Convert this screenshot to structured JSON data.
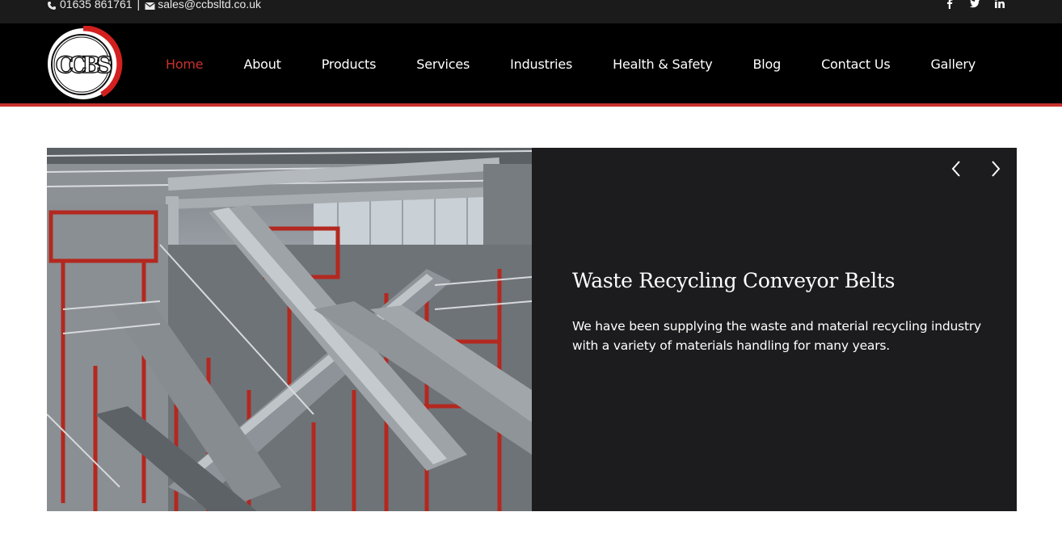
{
  "topbar": {
    "phone": "01635 861761",
    "separator": "|",
    "email": "sales@ccbsltd.co.uk",
    "social": [
      "facebook-icon",
      "twitter-icon",
      "linkedin-icon"
    ]
  },
  "header": {
    "logo_text": "CCBS",
    "nav": [
      {
        "label": "Home",
        "active": true
      },
      {
        "label": "About"
      },
      {
        "label": "Products"
      },
      {
        "label": "Services"
      },
      {
        "label": "Industries"
      },
      {
        "label": "Health & Safety"
      },
      {
        "label": "Blog"
      },
      {
        "label": "Contact Us"
      },
      {
        "label": "Gallery"
      }
    ]
  },
  "slider": {
    "title": "Waste Recycling Conveyor Belts",
    "description": "We have been supplying the waste and material recycling industry with a variety of materials handling for many years.",
    "prev_icon": "chevron-left-icon",
    "next_icon": "chevron-right-icon"
  },
  "colors": {
    "accent": "#c9302c",
    "topbar_bg": "#1b1b1b",
    "header_bg": "#000000",
    "slide_bg": "#1c1c1e"
  }
}
